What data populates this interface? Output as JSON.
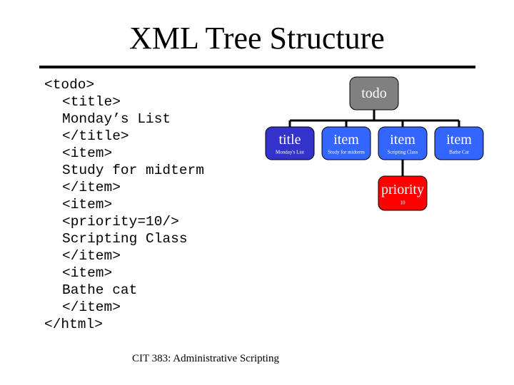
{
  "slide": {
    "title": "XML Tree Structure",
    "footer": "CIT 383: Administrative Scripting"
  },
  "code_lines": [
    {
      "text": "<todo>",
      "indent": 0
    },
    {
      "text": "<title>",
      "indent": 1
    },
    {
      "text": "Monday’s List",
      "indent": 1
    },
    {
      "text": "</title>",
      "indent": 1
    },
    {
      "text": "<item>",
      "indent": 1
    },
    {
      "text": "Study for midterm",
      "indent": 1
    },
    {
      "text": "</item>",
      "indent": 1
    },
    {
      "text": "<item>",
      "indent": 1
    },
    {
      "text": "<priority=10/>",
      "indent": 1
    },
    {
      "text": "Scripting Class",
      "indent": 1
    },
    {
      "text": "</item>",
      "indent": 1
    },
    {
      "text": "<item>",
      "indent": 1
    },
    {
      "text": "Bathe cat",
      "indent": 1
    },
    {
      "text": "</item>",
      "indent": 1
    },
    {
      "text": "</html>",
      "indent": 0
    }
  ],
  "tree": {
    "colors": {
      "root": "#808080",
      "title": "#3333cc",
      "item": "#3366ff",
      "priority": "#ff0000",
      "line": "#000000"
    },
    "root": {
      "label": "todo",
      "sublabel": ""
    },
    "children": [
      {
        "label": "title",
        "sublabel": "Monday's List",
        "kind": "title",
        "children": []
      },
      {
        "label": "item",
        "sublabel": "Study for midterm",
        "kind": "item",
        "children": []
      },
      {
        "label": "item",
        "sublabel": "Scripting Class",
        "kind": "item",
        "children": [
          {
            "label": "priority",
            "sublabel": "10",
            "kind": "priority"
          }
        ]
      },
      {
        "label": "item",
        "sublabel": "Bathe Cat",
        "kind": "item",
        "children": []
      }
    ]
  }
}
